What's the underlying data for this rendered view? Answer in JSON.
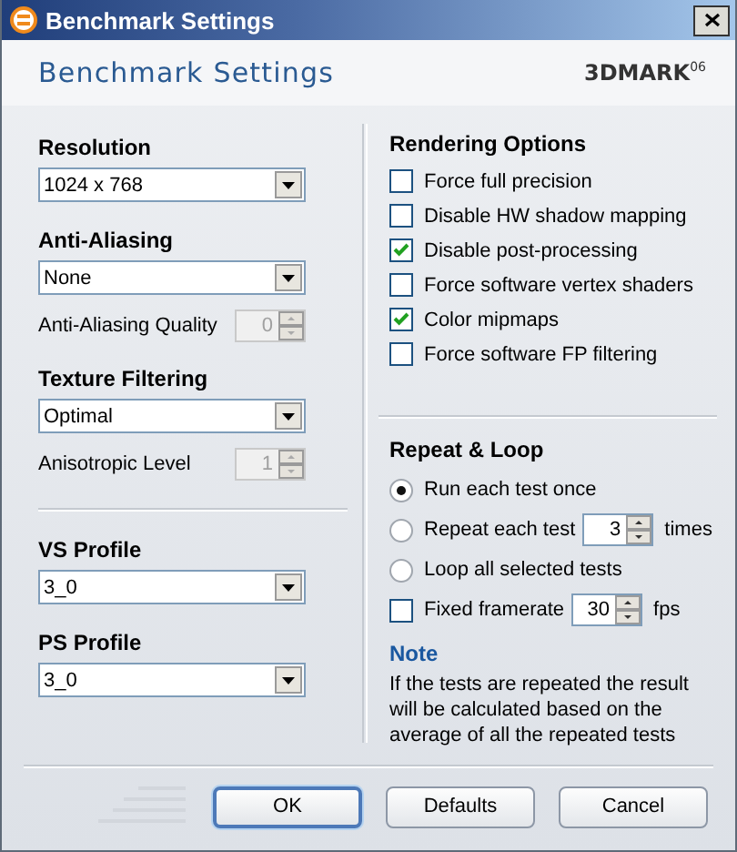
{
  "window": {
    "title": "Benchmark Settings"
  },
  "header": {
    "title": "Benchmark Settings",
    "logo": "3DMARK$^{06}$"
  },
  "left_groups": [
    {
      "items": [
        {
          "kind": "dropdown",
          "label": "Resolution",
          "value": "1024 x 768"
        },
        {
          "kind": "dropdown",
          "label": "Anti-Aliasing",
          "value": "None"
        },
        {
          "kind": "spin",
          "label": "Anti-Aliasing Quality",
          "value": "0",
          "disabled": true
        },
        {
          "kind": "dropdown",
          "label": "Texture Filtering",
          "value": "Optimal"
        },
        {
          "kind": "spin",
          "label": "Anisotropic Level",
          "value": "1",
          "disabled": true
        }
      ]
    },
    {
      "items": [
        {
          "kind": "dropdown",
          "label": "VS Profile",
          "value": "3_0"
        },
        {
          "kind": "dropdown",
          "label": "PS Profile",
          "value": "3_0"
        }
      ]
    }
  ],
  "rendering_options": {
    "title": "Rendering Options",
    "options": [
      {
        "label": "Force full precision",
        "checked": false
      },
      {
        "label": "Disable HW shadow mapping",
        "checked": false
      },
      {
        "label": "Disable post-processing",
        "checked": true
      },
      {
        "label": "Force software vertex shaders",
        "checked": false
      },
      {
        "label": "Color mipmaps",
        "checked": true
      },
      {
        "label": "Force software FP filtering",
        "checked": false
      }
    ]
  },
  "repeat_loop": {
    "title": "Repeat & Loop",
    "options": [
      {
        "kind": "radio",
        "label": "Run each test once",
        "selected": true
      },
      {
        "kind": "radio",
        "label": "Repeat each test",
        "selected": false,
        "value": "3",
        "suffix": "times"
      },
      {
        "kind": "radio",
        "label": "Loop all selected tests",
        "selected": false
      },
      {
        "kind": "checkbox",
        "label": "Fixed framerate",
        "checked": false,
        "value": "30",
        "suffix": "fps"
      }
    ]
  },
  "note": {
    "title": "Note",
    "text": "If the tests are repeated the result will be calculated based on the average of all the repeated tests"
  },
  "buttons": [
    {
      "label": "OK",
      "focused": true
    },
    {
      "label": "Defaults",
      "focused": false
    },
    {
      "label": "Cancel",
      "focused": false
    }
  ]
}
